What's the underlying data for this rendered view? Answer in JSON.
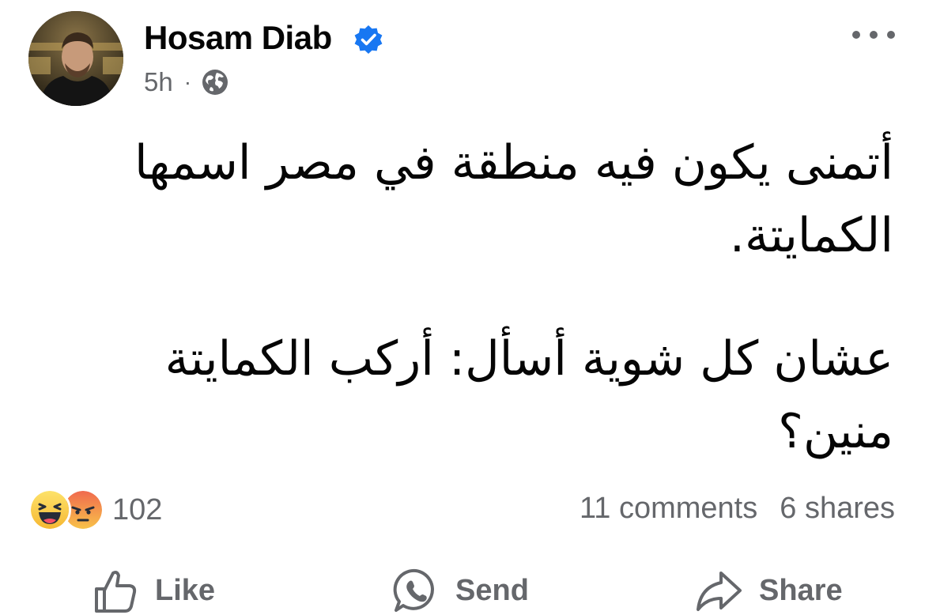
{
  "post": {
    "author": {
      "name": "Hosam Diab",
      "verified": true,
      "avatar_icon": "profile-photo"
    },
    "time": "5h",
    "separator": "·",
    "privacy_icon": "globe-icon",
    "more_icon": "more-horizontal-icon",
    "text": {
      "paragraph1": "أتمنى يكون فيه منطقة في مصر اسمها الكمايتة.",
      "paragraph2": "عشان كل شوية أسأل: أركب الكمايتة منين؟"
    },
    "reactions": {
      "icons": [
        "haha-reaction",
        "angry-reaction"
      ],
      "count": "102"
    },
    "stats": {
      "comments": "11 comments",
      "shares": "6 shares"
    },
    "actions": {
      "like_label": "Like",
      "send_label": "Send",
      "share_label": "Share"
    },
    "colors": {
      "verified": "#1877f2",
      "secondary_text": "#65676b",
      "primary_text": "#050505"
    }
  }
}
